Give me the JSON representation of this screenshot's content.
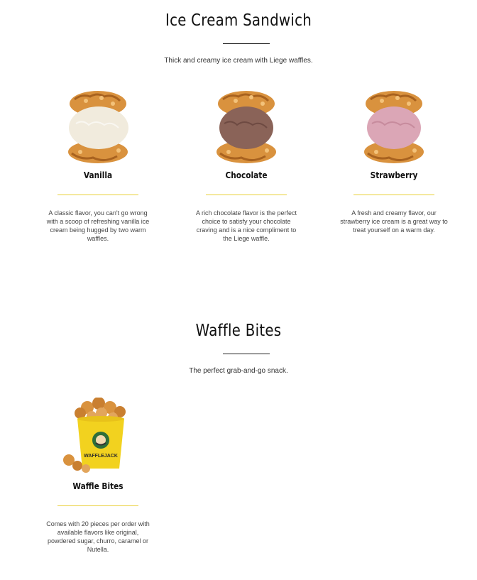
{
  "sections": [
    {
      "title": "Ice Cream Sandwich",
      "subtitle": "Thick and creamy ice cream with Liege waffles.",
      "items": [
        {
          "name": "Vanilla",
          "description": "A classic flavor, you can't go wrong with a scoop of refreshing vanilla ice cream being hugged by two warm waffles.",
          "scoop_color": "#f1ebdd"
        },
        {
          "name": "Chocolate",
          "description": "A rich chocolate flavor is the perfect choice to satisfy your chocolate craving and is a nice compliment to the Liege waffle.",
          "scoop_color": "#8a6358"
        },
        {
          "name": "Strawberry",
          "description": "A fresh and creamy flavor, our strawberry ice cream is a great way to treat yourself on a warm day.",
          "scoop_color": "#dba6b6"
        }
      ]
    },
    {
      "title": "Waffle Bites",
      "subtitle": "The perfect grab-and-go snack.",
      "items": [
        {
          "name": "Waffle Bites",
          "description": "Comes with 20 pieces per order with available flavors like original, powdered sugar, churro, caramel or Nutella.",
          "cup_brand": "WAFFLEJACK",
          "cup_color": "#f2d21f"
        }
      ]
    }
  ],
  "colors": {
    "accent_rule": "#e9cf35",
    "waffle": "#d9923e",
    "waffle_dark": "#a8621f"
  }
}
